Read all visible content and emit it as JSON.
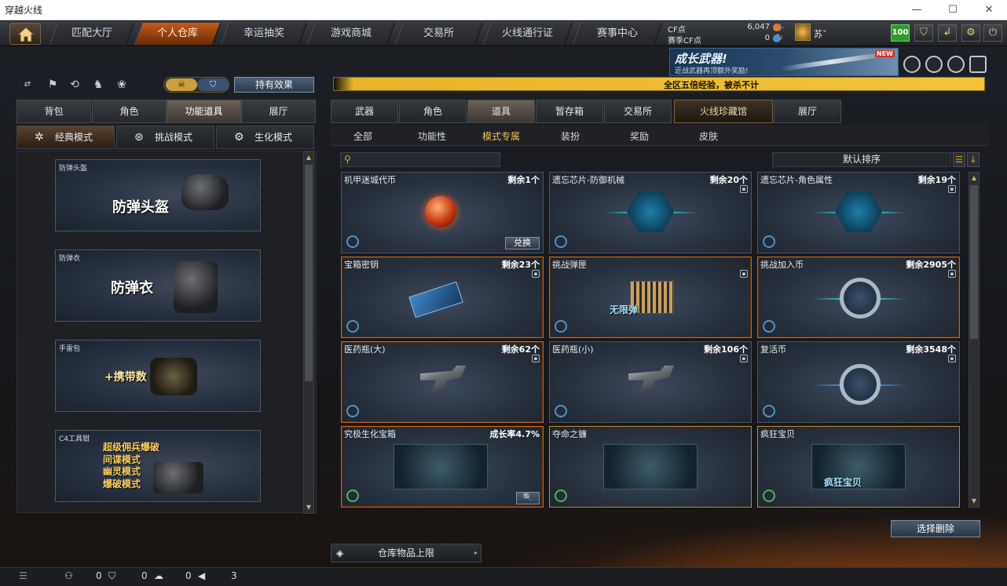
{
  "window": {
    "title": "穿越火线",
    "min": "—",
    "max": "☐",
    "close": "✕"
  },
  "topnav": {
    "tabs": [
      "匹配大厅",
      "个人仓库",
      "幸运抽奖",
      "游戏商城",
      "交易所",
      "火线通行证",
      "赛事中心"
    ],
    "active_index": 1
  },
  "currency": {
    "cf_label": "CF点",
    "cf_value": "6,047",
    "season_label": "赛季CF点",
    "season_value": "0"
  },
  "user": {
    "name": "苏ˇ",
    "level": "100"
  },
  "banner": {
    "title": "成长武器!",
    "subtitle": "近战武器再顶额外奖励!",
    "badge": "NEW"
  },
  "ticker": {
    "message": "全区五倍经验，被杀不计"
  },
  "left": {
    "toggle_a": "☠",
    "toggle_b": "⛉",
    "effects_button": "持有效果",
    "tabs": [
      "背包",
      "角色",
      "功能道具",
      "展厅"
    ],
    "active_tab": 2,
    "modes": [
      {
        "icon": "✲",
        "label": "经典模式"
      },
      {
        "icon": "⊛",
        "label": "挑战模式"
      },
      {
        "icon": "⚙",
        "label": "生化模式"
      }
    ],
    "items": [
      {
        "label": "防弹头盔",
        "big": "防弹头盔"
      },
      {
        "label": "防弹衣",
        "big": "防弹衣"
      },
      {
        "label": "手雷包",
        "big": "+携带数"
      },
      {
        "label": "C4工具钳",
        "lines": [
          "超级佣兵爆破",
          "间谍模式",
          "幽灵模式",
          "爆破模式"
        ]
      }
    ]
  },
  "right": {
    "tabs": [
      "武器",
      "角色",
      "道具",
      "暂存箱",
      "交易所",
      "火线珍藏馆",
      "展厅"
    ],
    "active_tab": 2,
    "subtabs": [
      "全部",
      "功能性",
      "模式专属",
      "装扮",
      "奖励",
      "皮肤"
    ],
    "active_subtab": 2,
    "search_placeholder": "",
    "sort_label": "默认排序",
    "cards": [
      {
        "name": "机甲迷城代币",
        "count": "剩余1个",
        "action": "兑换"
      },
      {
        "name": "遗忘芯片-防御机械",
        "count": "剩余20个"
      },
      {
        "name": "遗忘芯片-角色属性",
        "count": "剩余19个"
      },
      {
        "name": "宝箱密钥",
        "count": "剩余23个"
      },
      {
        "name": "挑战弹匣",
        "count": "",
        "overlay": "无限弹"
      },
      {
        "name": "挑战加入币",
        "count": "剩余2905个"
      },
      {
        "name": "医药瓶(大)",
        "count": "剩余62个"
      },
      {
        "name": "医药瓶(小)",
        "count": "剩余106个"
      },
      {
        "name": "复活币",
        "count": "剩余3548个"
      },
      {
        "name": "究极生化宝箱",
        "count": "成长率4.7%",
        "action": "🔍"
      },
      {
        "name": "夺命之镰",
        "count": ""
      },
      {
        "name": "疯狂宝贝",
        "count": "",
        "overlay": "疯狂宝贝"
      }
    ],
    "delete_button": "选择删除",
    "limit_button": "仓库物品上限"
  },
  "status": {
    "a": "0",
    "b": "0",
    "c": "0",
    "d": "3"
  }
}
